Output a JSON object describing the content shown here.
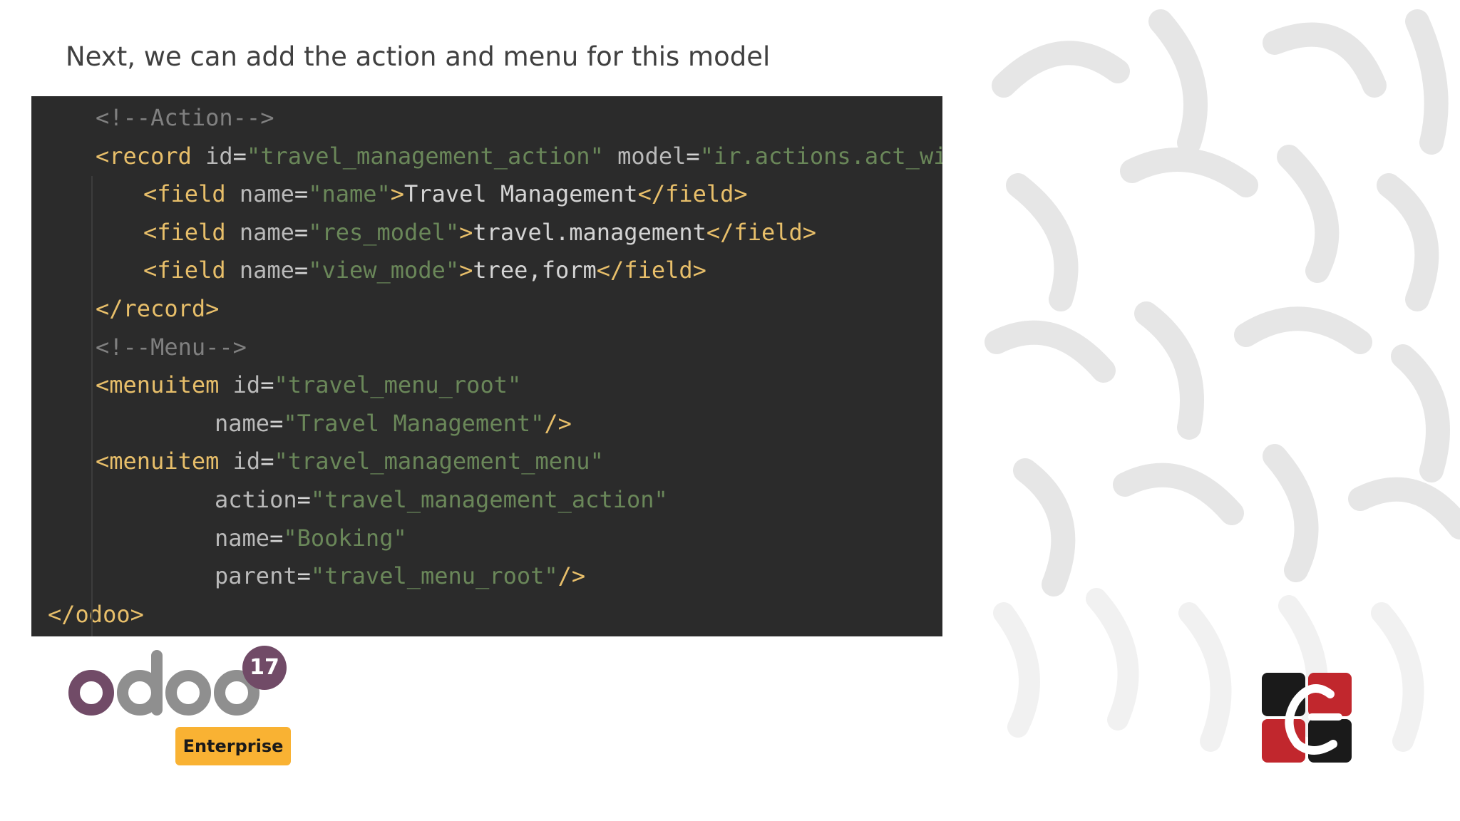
{
  "slide": {
    "title": "Next, we can add the action and menu for this model",
    "code_lines": [
      {
        "indent": 1,
        "tokens": [
          {
            "t": "<!--Action-->",
            "c": "cmt"
          }
        ]
      },
      {
        "indent": 1,
        "tokens": [
          {
            "t": "<record ",
            "c": "tag"
          },
          {
            "t": "id",
            "c": "attr"
          },
          {
            "t": "=",
            "c": "txt"
          },
          {
            "t": "\"travel_management_action\"",
            "c": "val"
          },
          {
            "t": " model",
            "c": "attr"
          },
          {
            "t": "=",
            "c": "txt"
          },
          {
            "t": "\"ir.actions.act_window\"",
            "c": "val"
          },
          {
            "t": ">",
            "c": "tag"
          }
        ]
      },
      {
        "indent": 2,
        "tokens": [
          {
            "t": "<field ",
            "c": "tag"
          },
          {
            "t": "name",
            "c": "attr"
          },
          {
            "t": "=",
            "c": "txt"
          },
          {
            "t": "\"name\"",
            "c": "val"
          },
          {
            "t": ">",
            "c": "tag"
          },
          {
            "t": "Travel Management",
            "c": "txt"
          },
          {
            "t": "</field>",
            "c": "tag"
          }
        ]
      },
      {
        "indent": 2,
        "tokens": [
          {
            "t": "<field ",
            "c": "tag"
          },
          {
            "t": "name",
            "c": "attr"
          },
          {
            "t": "=",
            "c": "txt"
          },
          {
            "t": "\"res_model\"",
            "c": "val"
          },
          {
            "t": ">",
            "c": "tag"
          },
          {
            "t": "travel.management",
            "c": "txt"
          },
          {
            "t": "</field>",
            "c": "tag"
          }
        ]
      },
      {
        "indent": 2,
        "tokens": [
          {
            "t": "<field ",
            "c": "tag"
          },
          {
            "t": "name",
            "c": "attr"
          },
          {
            "t": "=",
            "c": "txt"
          },
          {
            "t": "\"view_mode\"",
            "c": "val"
          },
          {
            "t": ">",
            "c": "tag"
          },
          {
            "t": "tree,form",
            "c": "txt"
          },
          {
            "t": "</field>",
            "c": "tag"
          }
        ]
      },
      {
        "indent": 1,
        "tokens": [
          {
            "t": "</record>",
            "c": "tag"
          }
        ]
      },
      {
        "indent": 1,
        "tokens": [
          {
            "t": "<!--Menu-->",
            "c": "cmt"
          }
        ]
      },
      {
        "indent": 1,
        "tokens": [
          {
            "t": "<menuitem ",
            "c": "tag"
          },
          {
            "t": "id",
            "c": "attr"
          },
          {
            "t": "=",
            "c": "txt"
          },
          {
            "t": "\"travel_menu_root\"",
            "c": "val"
          }
        ]
      },
      {
        "indent": 3,
        "tokens": [
          {
            "t": "name",
            "c": "attr"
          },
          {
            "t": "=",
            "c": "txt"
          },
          {
            "t": "\"Travel Management\"",
            "c": "val"
          },
          {
            "t": "/>",
            "c": "tag"
          }
        ]
      },
      {
        "indent": 1,
        "tokens": [
          {
            "t": "<menuitem ",
            "c": "tag"
          },
          {
            "t": "id",
            "c": "attr"
          },
          {
            "t": "=",
            "c": "txt"
          },
          {
            "t": "\"travel_management_menu\"",
            "c": "val"
          }
        ]
      },
      {
        "indent": 3,
        "tokens": [
          {
            "t": "action",
            "c": "attr"
          },
          {
            "t": "=",
            "c": "txt"
          },
          {
            "t": "\"travel_management_action\"",
            "c": "val"
          }
        ]
      },
      {
        "indent": 3,
        "tokens": [
          {
            "t": "name",
            "c": "attr"
          },
          {
            "t": "=",
            "c": "txt"
          },
          {
            "t": "\"Booking\"",
            "c": "val"
          }
        ]
      },
      {
        "indent": 3,
        "tokens": [
          {
            "t": "parent",
            "c": "attr"
          },
          {
            "t": "=",
            "c": "txt"
          },
          {
            "t": "\"travel_menu_root\"",
            "c": "val"
          },
          {
            "t": "/>",
            "c": "tag"
          }
        ]
      },
      {
        "indent": 0,
        "tokens": [
          {
            "t": "</odoo>",
            "c": "tag"
          }
        ]
      }
    ]
  },
  "branding": {
    "odoo_wordmark": "odoo",
    "odoo_version": "17",
    "edition_label": "Enterprise",
    "odoo_purple": "#714b67",
    "odoo_grey": "#8f8f8f",
    "edition_color": "#f9b233",
    "partner_logo_icon": "cybrosys-logo-icon",
    "partner_red": "#c1272d",
    "partner_dark": "#1a1a1a"
  },
  "theme": {
    "code_background": "#2b2b2b",
    "tag_color": "#e8bf6a",
    "value_color": "#6a8759",
    "comment_color": "#808080"
  }
}
